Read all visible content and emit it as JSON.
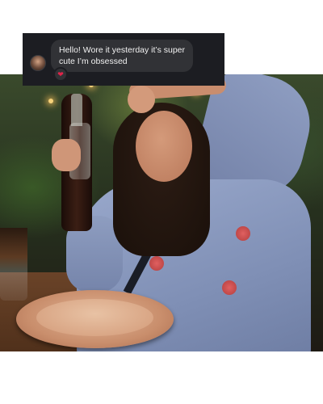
{
  "dm": {
    "message_text": "Hello! Wore it yesterday it’s super cute I’m obsessed",
    "reaction_emoji": "❤",
    "reaction_color": "#e0244a"
  },
  "photo": {
    "subject": "woman holding a glass soda bottle at a restaurant table",
    "icon_name": "photo"
  }
}
